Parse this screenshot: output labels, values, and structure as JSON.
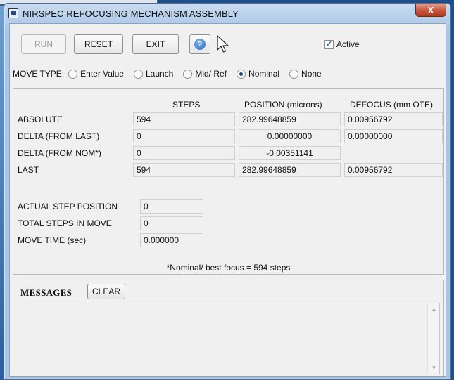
{
  "window": {
    "title": "NIRSPEC REFOCUSING MECHANISM ASSEMBLY",
    "close_label": "X"
  },
  "toolbar": {
    "run_label": "RUN",
    "reset_label": "RESET",
    "exit_label": "EXIT",
    "help_label": "?",
    "active_label": "Active",
    "active_checked": true
  },
  "move_type": {
    "label": "MOVE TYPE:",
    "options": [
      {
        "label": "Enter Value",
        "selected": false
      },
      {
        "label": "Launch",
        "selected": false
      },
      {
        "label": "Mid/ Ref",
        "selected": false
      },
      {
        "label": "Nominal",
        "selected": true
      },
      {
        "label": "None",
        "selected": false
      }
    ]
  },
  "table": {
    "headers": [
      "STEPS",
      "POSITION (microns)",
      "DEFOCUS (mm OTE)"
    ],
    "rows": [
      {
        "label": "ABSOLUTE",
        "steps": "594",
        "position": "282.99648859",
        "defocus": "0.00956792"
      },
      {
        "label": "DELTA (FROM LAST)",
        "steps": "0",
        "position": "0.00000000",
        "defocus": "0.00000000"
      },
      {
        "label": "DELTA (FROM NOM*)",
        "steps": "0",
        "position": "-0.00351141",
        "defocus": ""
      },
      {
        "label": "LAST",
        "steps": "594",
        "position": "282.99648859",
        "defocus": "0.00956792"
      }
    ]
  },
  "move_info": {
    "actual_step_label": "ACTUAL STEP POSITION",
    "actual_step_value": "0",
    "total_steps_label": "TOTAL STEPS IN MOVE",
    "total_steps_value": "0",
    "move_time_label": "MOVE TIME (sec)",
    "move_time_value": "0.000000"
  },
  "note": "*Nominal/ best focus = 594 steps",
  "messages": {
    "title": "MESSAGES",
    "clear_label": "CLEAR",
    "content": ""
  },
  "colors": {
    "desktop": "#1d4f8a",
    "titlebar": "#a9c4e4",
    "close": "#c5553d"
  }
}
